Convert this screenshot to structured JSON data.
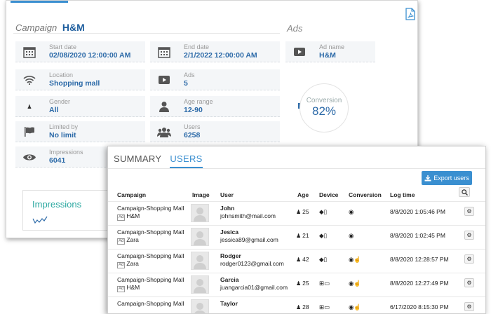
{
  "back_panel": {
    "campaign_label": "Campaign",
    "campaign_name": "H&M",
    "ads_label": "Ads",
    "fields": [
      {
        "icon": "calendar-icon",
        "label": "Start date",
        "value": "02/08/2020 12:00:00 AM"
      },
      {
        "icon": "calendar-icon",
        "label": "End date",
        "value": "2/1/2022 12:00:00 AM"
      },
      {
        "icon": "wifi-icon",
        "label": "Location",
        "value": "Shopping mall"
      },
      {
        "icon": "play-icon",
        "label": "Ads",
        "value": "5"
      },
      {
        "icon": "person-icon",
        "label": "Gender",
        "value": "All"
      },
      {
        "icon": "user-icon",
        "label": "Age range",
        "value": "12-90"
      },
      {
        "icon": "flag-icon",
        "label": "Limited by",
        "value": "No limit"
      },
      {
        "icon": "users-icon",
        "label": "Users",
        "value": "6258"
      },
      {
        "icon": "eye-icon",
        "label": "Impressions",
        "value": "6041"
      }
    ],
    "ad_name": {
      "label": "Ad name",
      "value": "H&M"
    },
    "conversion": {
      "label": "Conversion",
      "value": "82%"
    },
    "impressions_card_title": "Impressions"
  },
  "front_panel": {
    "tabs": [
      {
        "label": "SUMMARY",
        "active": false
      },
      {
        "label": "USERS",
        "active": true
      }
    ],
    "export_label": "Export users",
    "columns": [
      "Campaign",
      "Image",
      "User",
      "Age",
      "Device",
      "Conversion",
      "Log time"
    ],
    "rows": [
      {
        "campaign": "Campaign-Shopping Mall",
        "ad": "H&M",
        "name": "John",
        "email": "johnsmith@mail.com",
        "age": "25",
        "devices": "◆▯",
        "conversion": "◉",
        "log": "8/8/2020 1:05:46 PM"
      },
      {
        "campaign": "Campaign-Shopping Mall",
        "ad": "Zara",
        "name": "Jesica",
        "email": "jessica89@gmail.com",
        "age": "21",
        "devices": "◆▯",
        "conversion": "◉",
        "log": "8/8/2020 1:02:45 PM"
      },
      {
        "campaign": "Campaign-Shopping Mall",
        "ad": "Zara",
        "name": "Rodger",
        "email": "rodger0123@gmail.com",
        "age": "42",
        "devices": "◆▯",
        "conversion": "◉☝",
        "log": "8/8/2020 12:28:57 PM"
      },
      {
        "campaign": "Campaign-Shopping Mall",
        "ad": "H&M",
        "name": "Garcia",
        "email": "juangarcia01@gmail.com",
        "age": "25",
        "devices": "⊞▭",
        "conversion": "◉☝",
        "log": "8/8/2020 12:27:49 PM"
      },
      {
        "campaign": "Campaign-Shopping Mall",
        "ad": "",
        "name": "Taylor",
        "email": "",
        "age": "28",
        "devices": "⊞▭",
        "conversion": "◉☝",
        "log": "6/17/2020 8:15:30 PM"
      }
    ]
  },
  "colors": {
    "accent": "#3a8fd0",
    "value_text": "#2c6aa8"
  }
}
